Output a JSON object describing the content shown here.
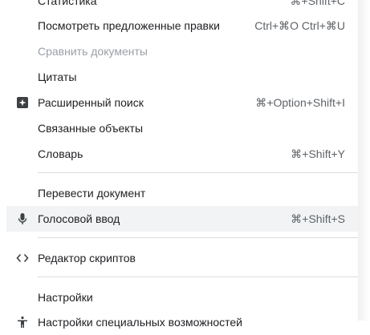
{
  "menu": {
    "items": [
      {
        "label": "Статистика",
        "shortcut": "⌘+Shift+C"
      },
      {
        "label": "Посмотреть предложенные правки",
        "shortcut": "Ctrl+⌘O Ctrl+⌘U"
      },
      {
        "label": "Сравнить документы",
        "shortcut": ""
      },
      {
        "label": "Цитаты",
        "shortcut": ""
      },
      {
        "label": "Расширенный поиск",
        "shortcut": "⌘+Option+Shift+I",
        "icon": "explore-sparkle-icon"
      },
      {
        "label": "Связанные объекты",
        "shortcut": ""
      },
      {
        "label": "Словарь",
        "shortcut": "⌘+Shift+Y"
      },
      {
        "label": "Перевести документ",
        "shortcut": ""
      },
      {
        "label": "Голосовой ввод",
        "shortcut": "⌘+Shift+S",
        "icon": "microphone-icon"
      },
      {
        "label": "Редактор скриптов",
        "shortcut": "",
        "icon": "code-brackets-icon"
      },
      {
        "label": "Настройки",
        "shortcut": ""
      },
      {
        "label": "Настройки специальных возможностей",
        "shortcut": "",
        "icon": "accessibility-icon"
      }
    ]
  },
  "colors": {
    "text": "#202124",
    "disabled_text": "#9aa0a6",
    "shortcut_text": "#5f6368",
    "hover_background": "#f1f3f4",
    "divider": "#dadce0"
  }
}
